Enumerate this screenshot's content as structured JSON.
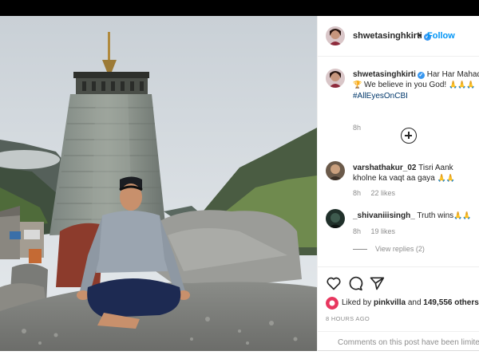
{
  "post": {
    "author": "shwetasinghkirti",
    "follow_label": "Follow",
    "separator": "•",
    "verified_mark": "✓",
    "caption": {
      "username": "shwetasinghkirti",
      "line1": "Har Har Mahadev",
      "line2_emoji": "🏆",
      "line2": "We believe in you God!",
      "line2_emojis": "🙏🙏🙏",
      "hashtag": "#AllEyesOnCBI",
      "time": "8h"
    },
    "comments": [
      {
        "username": "varshathakur_02",
        "text_part1": "Tisri Aank",
        "text_part2": "kholne ka vaqt aa gaya",
        "emojis": "🙏🙏",
        "time": "8h",
        "likes": "22 likes"
      },
      {
        "username": "_shivaniiisingh_",
        "text": "Truth wins",
        "emojis": "🙏🙏",
        "time": "8h",
        "likes": "19 likes"
      }
    ],
    "view_replies": "View replies (2)",
    "liked_by": {
      "prefix": "Liked by",
      "user": "pinkvilla",
      "connector": "and",
      "count": "149,556 others"
    },
    "post_time": "8 HOURS AGO",
    "comments_limited": "Comments on this post have been limited."
  },
  "icons": {
    "like": "heart-icon",
    "comment": "comment-icon",
    "share": "share-icon",
    "more_comments": "plus-circle-icon"
  },
  "colors": {
    "link_blue": "#0095f6",
    "hashtag": "#00376b",
    "muted": "#8e8e8e",
    "text": "#262626"
  }
}
